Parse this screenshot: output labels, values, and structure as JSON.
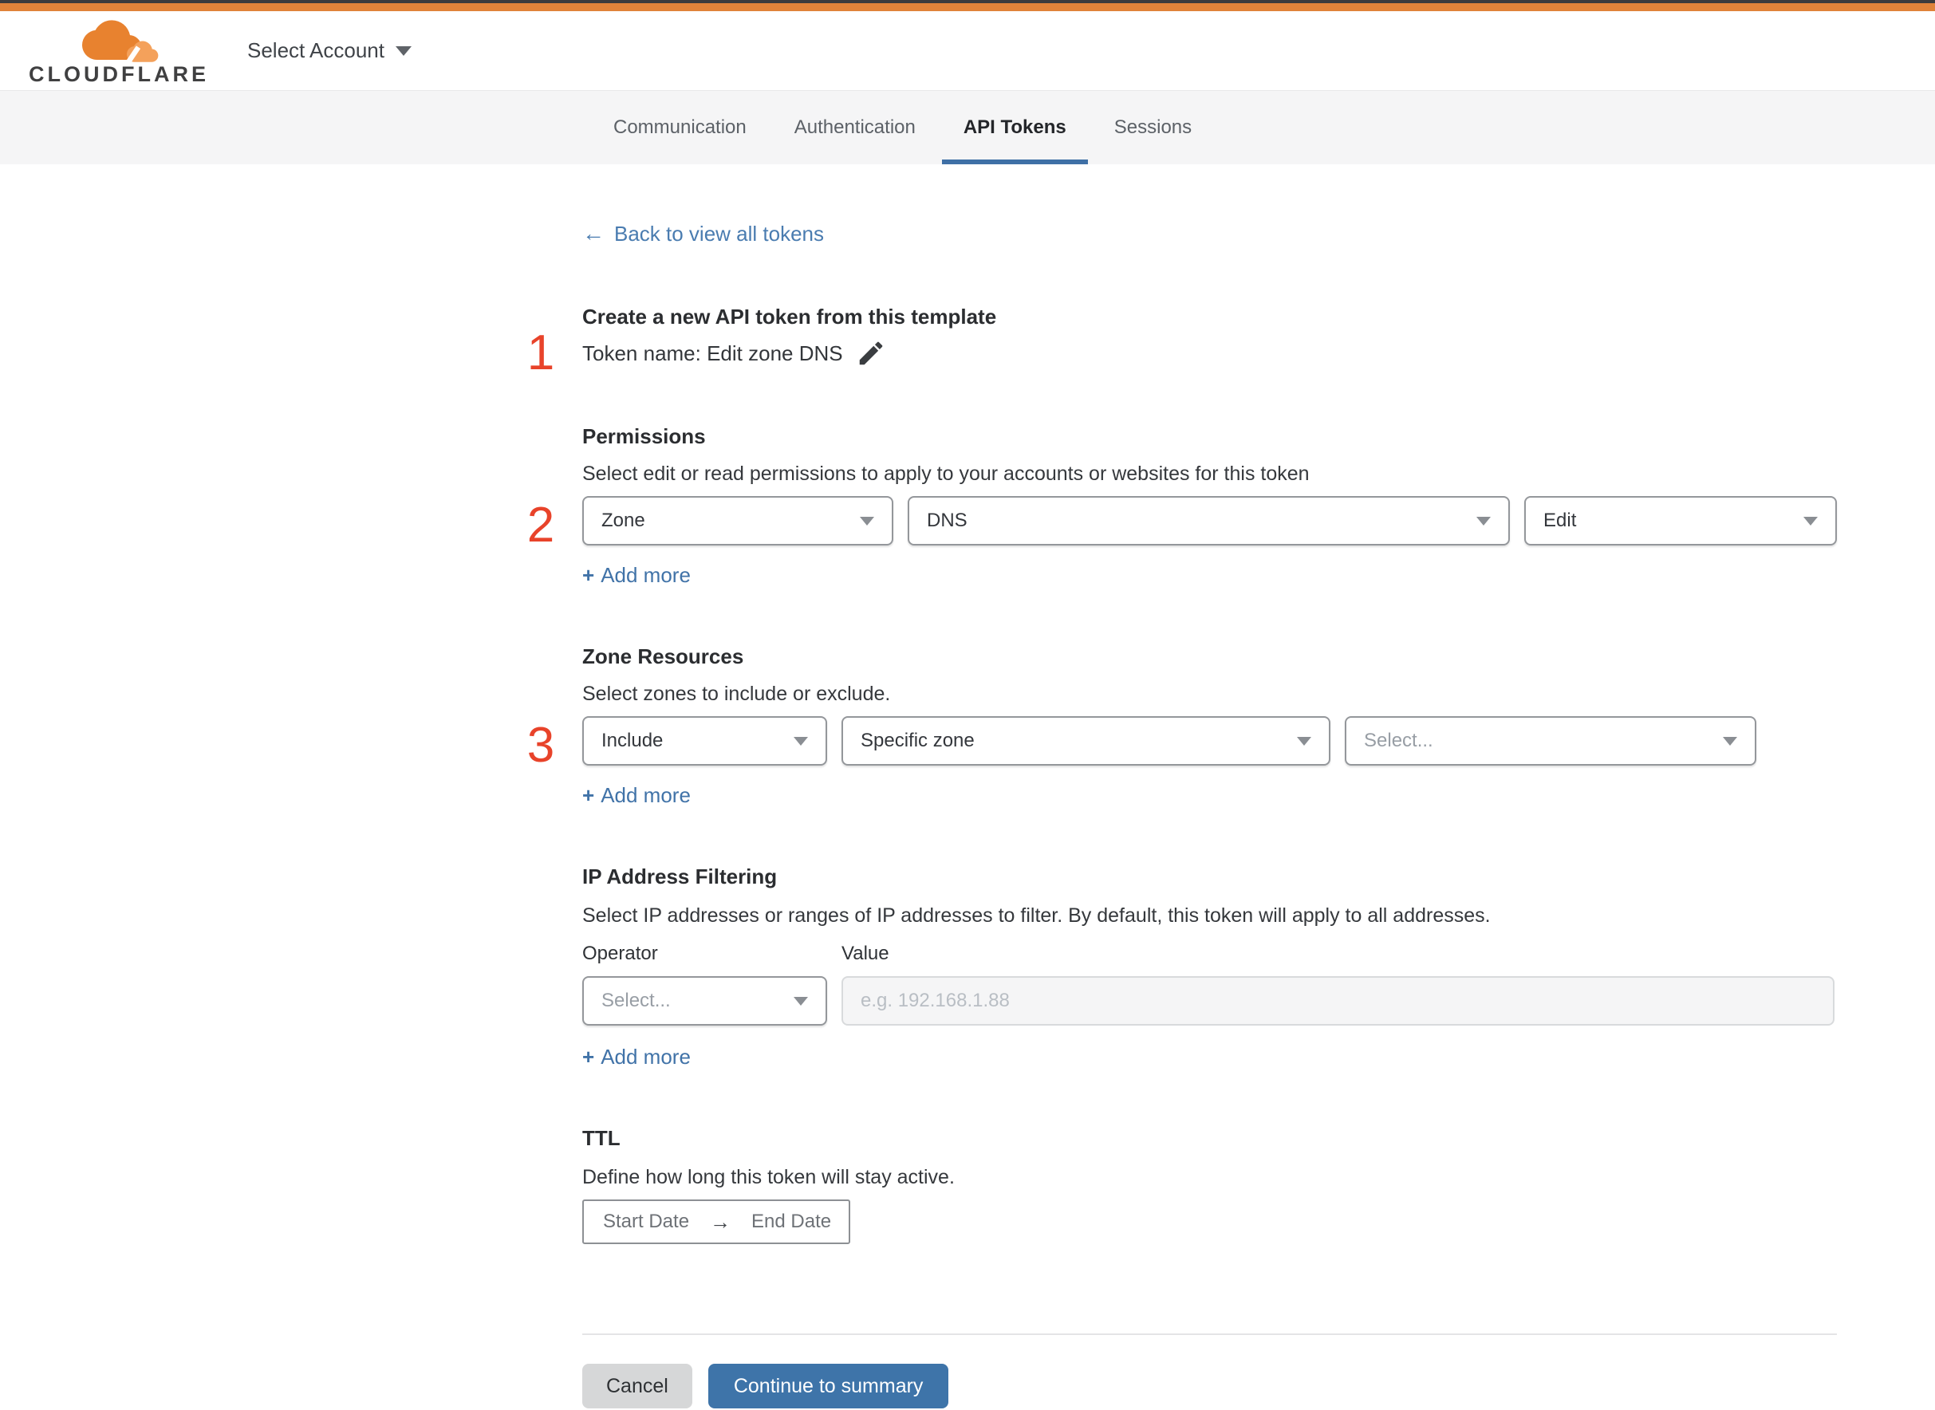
{
  "colors": {
    "top_accent_orange": "#e0833a",
    "step_number_red": "#e8432a",
    "link_blue": "#4a7cb0",
    "active_tab_underline_blue": "#3f70a6",
    "continue_button_blue": "#3e74a9"
  },
  "header": {
    "logo_text": "CLOUDFLARE",
    "account_selector_label": "Select Account"
  },
  "tabs": [
    {
      "label": "Communication",
      "active": false
    },
    {
      "label": "Authentication",
      "active": false
    },
    {
      "label": "API Tokens",
      "active": true
    },
    {
      "label": "Sessions",
      "active": false
    }
  ],
  "navigation": {
    "back_arrow": "←",
    "back_label": "Back to view all tokens"
  },
  "steps": [
    "1",
    "2",
    "3"
  ],
  "token_template": {
    "heading": "Create a new API token from this template",
    "token_name": "Token name: Edit zone DNS"
  },
  "permissions": {
    "heading": "Permissions",
    "description": "Select edit or read permissions to apply to your accounts or websites for this token",
    "scope": "Zone",
    "service": "DNS",
    "access": "Edit"
  },
  "zone_resources": {
    "heading": "Zone Resources",
    "description": "Select zones to include or exclude.",
    "mode": "Include",
    "type": "Specific zone",
    "zone_placeholder": "Select..."
  },
  "ip_filtering": {
    "heading": "IP Address Filtering",
    "description": "Select IP addresses or ranges of IP addresses to filter. By default, this token will apply to all addresses.",
    "operator_label": "Operator",
    "value_label": "Value",
    "operator_placeholder": "Select...",
    "value_placeholder": "e.g. 192.168.1.88"
  },
  "ttl": {
    "heading": "TTL",
    "description": "Define how long this token will stay active.",
    "start_date": "Start Date",
    "arrow": "→",
    "end_date": "End Date"
  },
  "actions": {
    "plus": "+",
    "add_more": "Add more",
    "cancel": "Cancel",
    "continue": "Continue to summary"
  }
}
